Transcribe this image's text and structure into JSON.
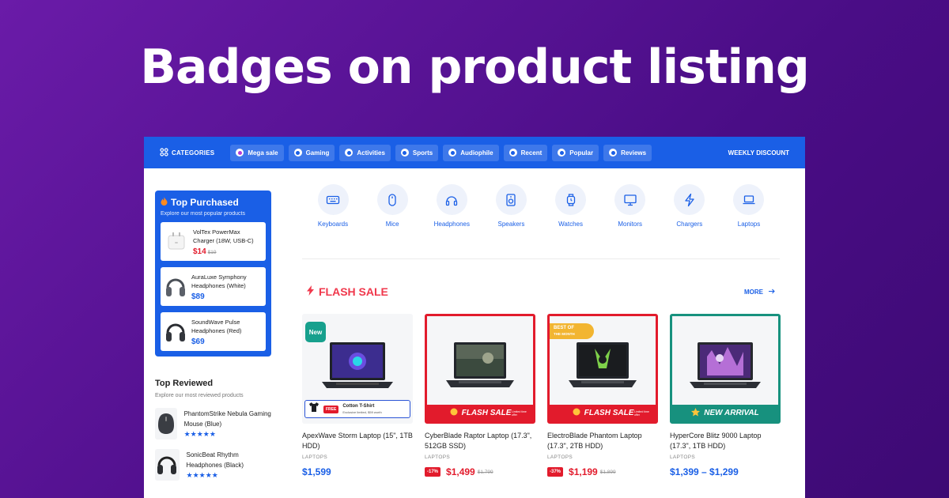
{
  "hero": {
    "title": "Badges on product listing"
  },
  "topnav": {
    "categories_label": "CATEGORIES",
    "pills": [
      "Mega sale",
      "Gaming",
      "Activities",
      "Sports",
      "Audiophile",
      "Recent",
      "Popular",
      "Reviews"
    ],
    "weekly": "WEEKLY DISCOUNT"
  },
  "sidebar": {
    "top_purchased": {
      "title": "Top Purchased",
      "subtitle": "Explore our most popular products",
      "items": [
        {
          "name": "VolTex PowerMax Charger (18W, USB-C)",
          "price": "$14",
          "old_price": "$19"
        },
        {
          "name": "AuraLuxe Symphony Headphones (White)",
          "price": "$89"
        },
        {
          "name": "SoundWave Pulse Headphones (Red)",
          "price": "$69"
        }
      ]
    },
    "top_reviewed": {
      "title": "Top Reviewed",
      "subtitle": "Explore our most reviewed products",
      "items": [
        {
          "name": "PhantomStrike Nebula Gaming Mouse (Blue)",
          "stars": "★★★★★"
        },
        {
          "name": "SonicBeat Rhythm Headphones (Black)",
          "stars": "★★★★★"
        }
      ]
    }
  },
  "categories": [
    "Keyboards",
    "Mice",
    "Headphones",
    "Speakers",
    "Watches",
    "Monitors",
    "Chargers",
    "Laptops"
  ],
  "flash": {
    "title": "FLASH SALE",
    "more": "MORE"
  },
  "products": [
    {
      "name": "ApexWave Storm Laptop (15\", 1TB HDD)",
      "category": "LAPTOPS",
      "price": "$1,599",
      "badge": "New",
      "gift": {
        "free": "FREE",
        "title": "Cotton T-Shirt",
        "note": "Exclusive limited, $59 worth"
      }
    },
    {
      "name": "CyberBlade Raptor Laptop (17.3\", 512GB SSD)",
      "category": "LAPTOPS",
      "price": "$1,499",
      "old_price": "$1,799",
      "discount": "-17%",
      "strip": "FLASH SALE",
      "strip_tag": "Limited time offer"
    },
    {
      "name": "ElectroBlade Phantom Laptop (17.3\", 2TB HDD)",
      "category": "LAPTOPS",
      "price": "$1,199",
      "old_price": "$1,899",
      "discount": "-37%",
      "strip": "FLASH SALE",
      "strip_tag": "Limited time offer",
      "best": {
        "line1": "BEST OF",
        "line2": "THE MONTH"
      }
    },
    {
      "name": "HyperCore Blitz 9000 Laptop (17.3\", 1TB HDD)",
      "category": "LAPTOPS",
      "price": "$1,399 – $1,299",
      "strip": "NEW ARRIVAL"
    }
  ],
  "colors": {
    "brand": "#1a5fe6",
    "sale": "#e21b2c",
    "new": "#17a08d",
    "best": "#f2b531",
    "flash_title": "#f0384c"
  }
}
